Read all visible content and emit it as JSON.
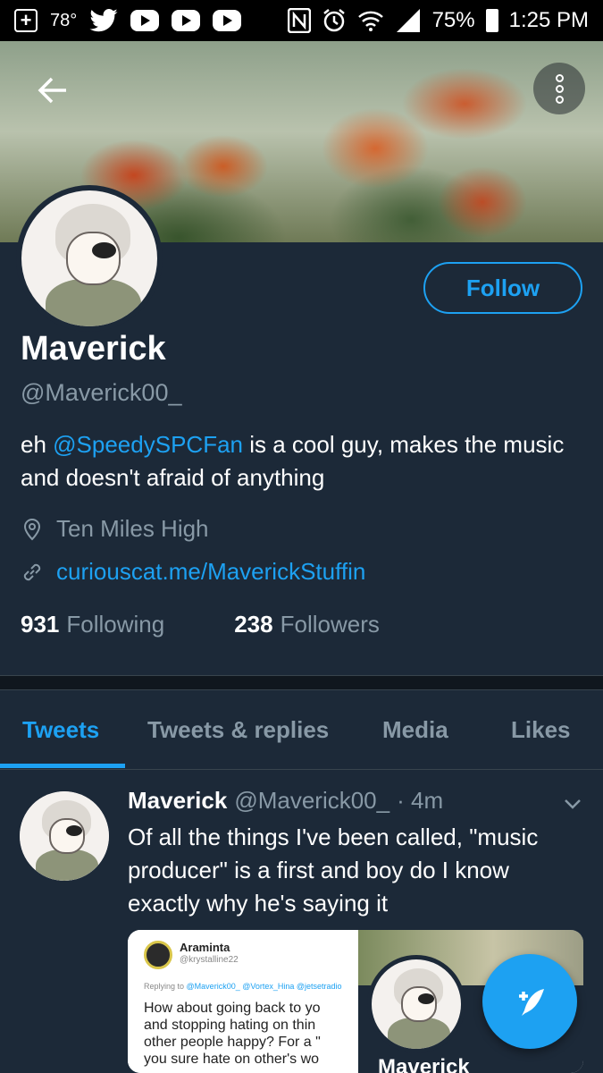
{
  "status_bar": {
    "temperature": "78°",
    "battery": "75%",
    "time": "1:25 PM"
  },
  "profile": {
    "name": "Maverick",
    "handle": "@Maverick00_",
    "follow_label": "Follow",
    "bio_prefix": "eh ",
    "bio_mention": "@SpeedySPCFan",
    "bio_suffix": " is a cool guy, makes the music and doesn't afraid of anything",
    "location": "Ten Miles High",
    "link": "curiouscat.me/MaverickStuffin",
    "following_count": "931",
    "following_label": "Following",
    "followers_count": "238",
    "followers_label": "Followers"
  },
  "tabs": [
    {
      "label": "Tweets",
      "active": true
    },
    {
      "label": "Tweets & replies",
      "active": false
    },
    {
      "label": "Media",
      "active": false
    },
    {
      "label": "Likes",
      "active": false
    }
  ],
  "tweet": {
    "name": "Maverick",
    "handle": "@Maverick00_",
    "time": "· 4m",
    "text": "Of all the things I've been called, \"music producer\" is a first and boy do I know exactly why he's saying it",
    "embed": {
      "author_name": "Araminta",
      "author_handle": "@krystalline22",
      "replying_prefix": "Replying to",
      "replying_to": "@Maverick00_ @Vortex_Hina @jetsetradio",
      "body": "How about going back to yo\nand stopping hating on thin\nother people happy? For a \"\nyou sure hate on other's wo",
      "card_name": "Maverick"
    }
  },
  "colors": {
    "background": "#1c2938",
    "accent": "#1da1f2",
    "secondary_text": "#8899a6"
  }
}
